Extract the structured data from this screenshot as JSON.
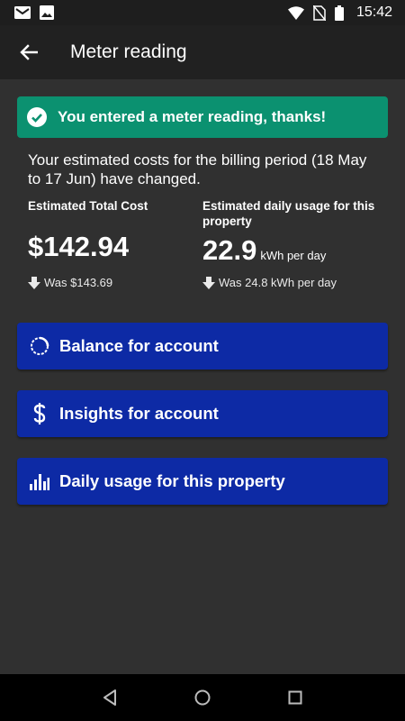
{
  "status_bar": {
    "time": "15:42",
    "icons": [
      "gmail-icon",
      "image-icon",
      "wifi-icon",
      "no-sim-icon",
      "battery-icon"
    ]
  },
  "app_bar": {
    "title": "Meter reading",
    "back_icon": "arrow-back-icon"
  },
  "banner": {
    "text": "You entered a meter reading, thanks!",
    "icon": "check-circle-icon",
    "color": "#0b9170"
  },
  "estimate": {
    "text": "Your estimated costs for the billing period (18 May to 17 Jun) have changed."
  },
  "cost": {
    "label": "Estimated Total Cost",
    "value": "$142.94",
    "was": "Was $143.69"
  },
  "usage": {
    "label": "Estimated daily usage for this property",
    "value": "22.9",
    "unit": "kWh per day",
    "was": "Was 24.8 kWh per day"
  },
  "actions": [
    {
      "label": "Balance for account",
      "icon": "balance-ring-icon"
    },
    {
      "label": "Insights for account",
      "icon": "dollar-icon"
    },
    {
      "label": "Daily usage for this property",
      "icon": "bar-chart-icon"
    }
  ],
  "colors": {
    "background": "#303030",
    "button": "#0d2aa5",
    "success": "#0b9170"
  },
  "nav_bar": {
    "icons": [
      "back-triangle-icon",
      "home-circle-icon",
      "recents-square-icon"
    ]
  }
}
